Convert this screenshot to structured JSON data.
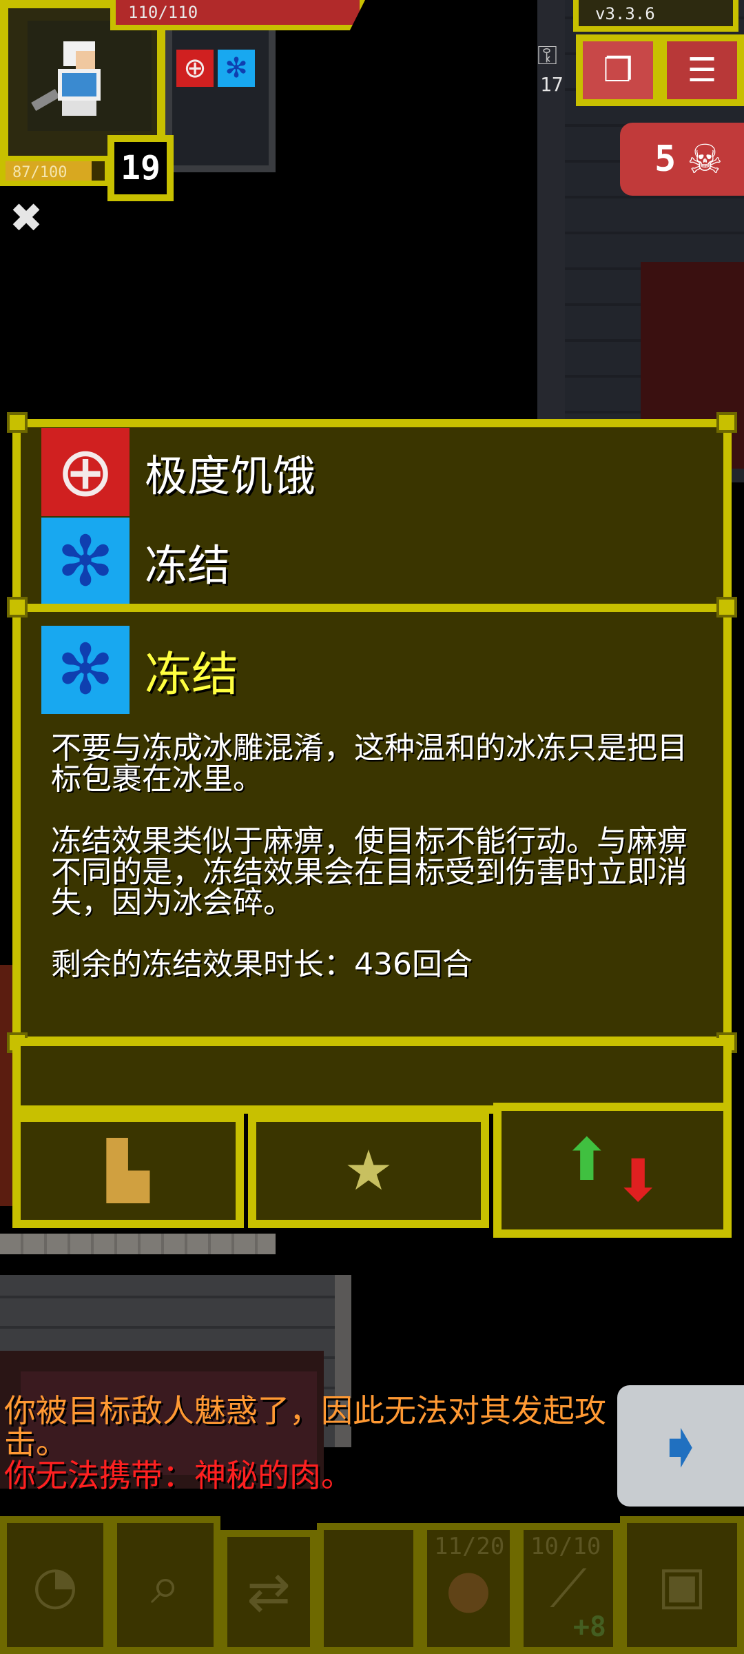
{
  "hud": {
    "hp_text": "110/110",
    "hp_fraction": 1.0,
    "exp_text": "87/100",
    "exp_fraction": 0.87,
    "level": "19",
    "version": "v3.3.6",
    "key_count": "17",
    "danger_count": "5",
    "icons": {
      "sat": "crossed-bones-icon",
      "journal": "journal-icon",
      "menu": "menu-icon",
      "key": "key-icon",
      "skull": "skull-icon"
    }
  },
  "buffs": [
    {
      "name": "hunger-icon",
      "glyph": "⊕",
      "color": "#d02020"
    },
    {
      "name": "frozen-icon",
      "glyph": "✻",
      "color": "#18a8f0"
    }
  ],
  "list": {
    "items": [
      {
        "label": "极度饥饿"
      },
      {
        "label": "冻结"
      }
    ]
  },
  "detail": {
    "title": "冻结",
    "body": "不要与冻成冰雕混淆，这种温和的冰冻只是把目标包裹在冰里。\n\n冻结效果类似于麻痹，使目标不能行动。与麻痹不同的是，冻结效果会在目标受到伤害时立即消失，因为冰会碎。\n\n剩余的冻结效果时长：436回合"
  },
  "tabs": {
    "books_icon": "books-icon",
    "star_icon": "star-icon",
    "arrows_icon": "sort-arrows-icon"
  },
  "log": {
    "line1": "你被目标敌人魅惑了，因此无法对其发起攻击。",
    "line2": "你无法携带：神秘的肉。"
  },
  "toolbar": {
    "slot2_count": "11/20",
    "slot3_count": "10/10",
    "slot3_bonus": "+8"
  }
}
